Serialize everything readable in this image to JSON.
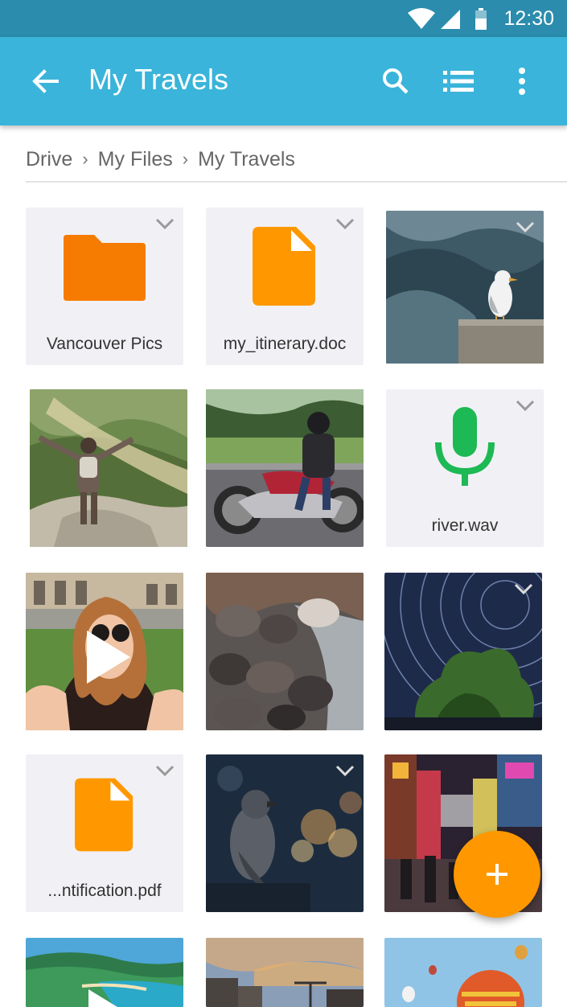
{
  "status_bar": {
    "time": "12:30"
  },
  "app_bar": {
    "title": "My Travels",
    "back_icon": "arrow-back-icon",
    "actions": [
      "search-icon",
      "list-view-icon",
      "more-vert-icon"
    ]
  },
  "breadcrumb": [
    "Drive",
    "My Files",
    "My Travels"
  ],
  "files": [
    {
      "kind": "folder",
      "name": "Vancouver Pics",
      "color": "#f57c00"
    },
    {
      "kind": "document",
      "name": "my_itinerary.doc",
      "color": "#ff9800"
    },
    {
      "kind": "photo",
      "subject": "seagull on ledge"
    },
    {
      "kind": "photo",
      "subject": "hiker with arms raised"
    },
    {
      "kind": "photo",
      "subject": "motorcycle rider"
    },
    {
      "kind": "audio",
      "name": "river.wav",
      "color": "#1db954"
    },
    {
      "kind": "video",
      "subject": "selfie with sunglasses"
    },
    {
      "kind": "photo",
      "subject": "campfire rocks"
    },
    {
      "kind": "photo",
      "subject": "star trails over tree"
    },
    {
      "kind": "document",
      "name": "...ntification.pdf",
      "color": "#ff9800"
    },
    {
      "kind": "photo",
      "subject": "bird with bokeh"
    },
    {
      "kind": "photo",
      "subject": "city street at night"
    },
    {
      "kind": "video",
      "subject": "tropical coastline"
    },
    {
      "kind": "photo",
      "subject": "sunset skyline"
    },
    {
      "kind": "photo",
      "subject": "hot air balloons"
    }
  ],
  "fab": {
    "icon": "add-icon",
    "color": "#ff9800"
  },
  "colors": {
    "status_bar": "#2b8cad",
    "app_bar": "#3ab4da",
    "tile_bg": "#f1f1f5"
  }
}
